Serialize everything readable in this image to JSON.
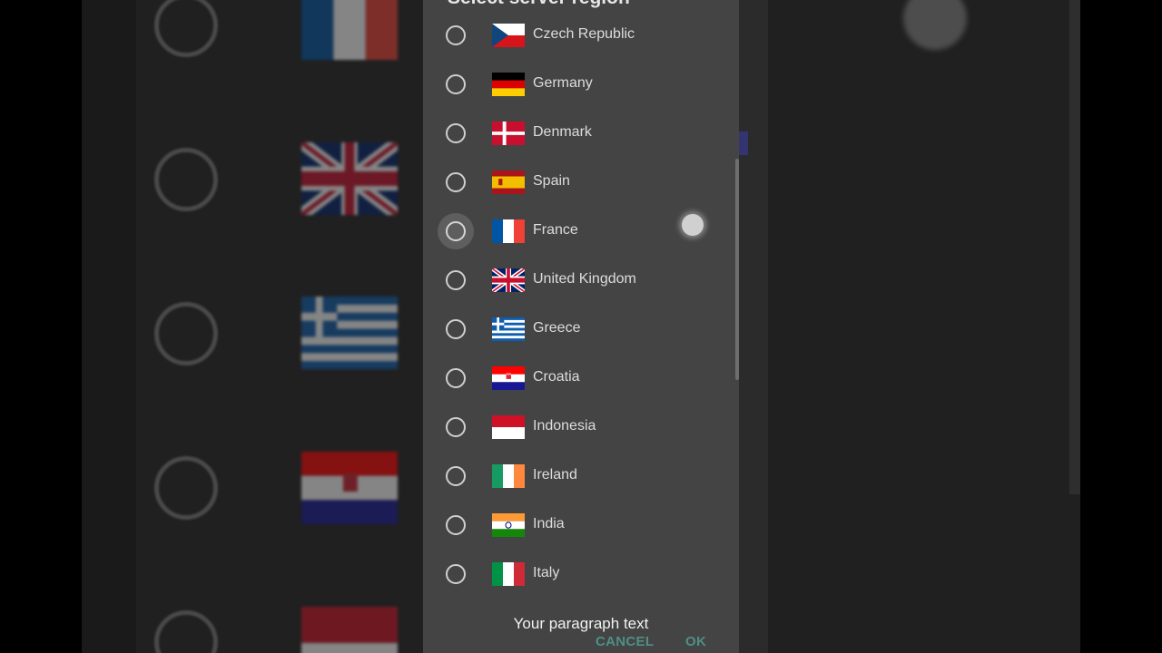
{
  "dialog": {
    "title": "Select server region",
    "selected_index": -1,
    "pressed_index": 4,
    "items": [
      {
        "label": "Czech Republic",
        "flag": "flag-czech-republic"
      },
      {
        "label": "Germany",
        "flag": "flag-germany"
      },
      {
        "label": "Denmark",
        "flag": "flag-denmark"
      },
      {
        "label": "Spain",
        "flag": "flag-spain"
      },
      {
        "label": "France",
        "flag": "flag-france"
      },
      {
        "label": "United Kingdom",
        "flag": "flag-united-kingdom"
      },
      {
        "label": "Greece",
        "flag": "flag-greece"
      },
      {
        "label": "Croatia",
        "flag": "flag-croatia"
      },
      {
        "label": "Indonesia",
        "flag": "flag-indonesia"
      },
      {
        "label": "Ireland",
        "flag": "flag-ireland"
      },
      {
        "label": "India",
        "flag": "flag-india"
      },
      {
        "label": "Italy",
        "flag": "flag-italy"
      }
    ],
    "cancel_label": "CANCEL",
    "ok_label": "OK"
  },
  "caption": "Your paragraph text",
  "colors": {
    "dialog_bg": "#444444",
    "button_text": "#4f8f86",
    "radio_outline": "#cfcfcf",
    "page_bg": "#000000"
  }
}
